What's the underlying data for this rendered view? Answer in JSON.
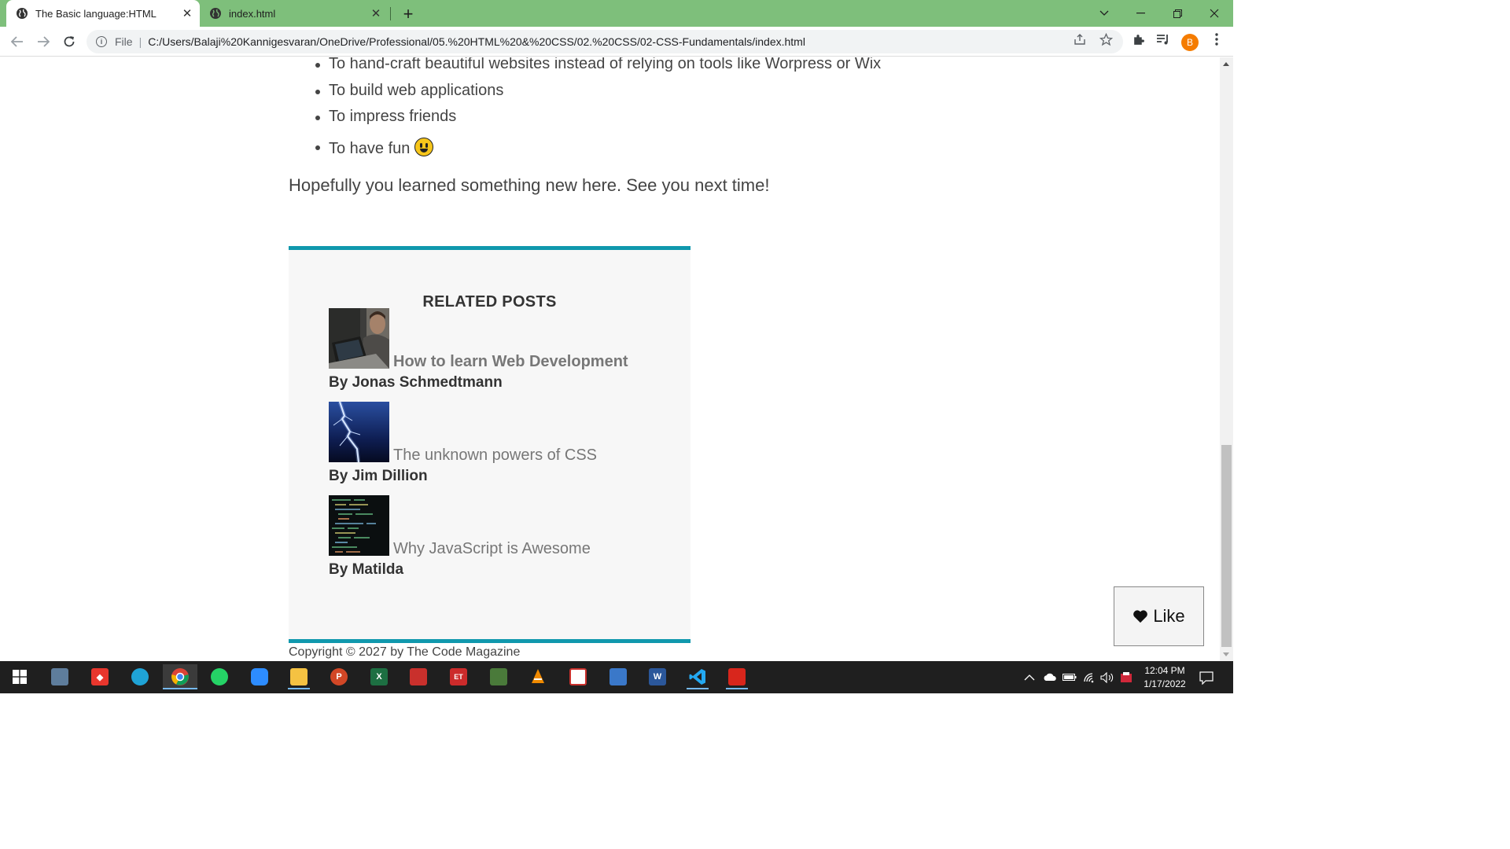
{
  "browser": {
    "tabs": [
      {
        "title": "The Basic language:HTML",
        "active": true
      },
      {
        "title": "index.html",
        "active": false
      }
    ],
    "address": {
      "scheme": "File",
      "url": "C:/Users/Balaji%20Kannigesvaran/OneDrive/Professional/05.%20HTML%20&%20CSS/02.%20CSS/02-CSS-Fundamentals/index.html"
    },
    "profile_initial": "B",
    "accent": "#7ebf7b"
  },
  "page": {
    "reasons": [
      "To hand-craft beautiful websites instead of relying on tools like Worpress or Wix",
      "To build web applications",
      "To impress friends",
      "To have fun"
    ],
    "closing": "Hopefully you learned something new here. See you next time!",
    "related": {
      "heading": "RELATED POSTS",
      "posts": [
        {
          "title": "How to learn Web Development",
          "author": "By Jonas Schmedtmann",
          "thumb": "person-laptop-photo"
        },
        {
          "title": "The unknown powers of CSS",
          "author": "By Jim Dillion",
          "thumb": "lightning-photo"
        },
        {
          "title": "Why JavaScript is Awesome",
          "author": "By Matilda",
          "thumb": "code-screen-photo"
        }
      ]
    },
    "copyright": "Copyright © 2027 by The Code Magazine",
    "like_label": "Like",
    "border_color": "#1098ad"
  },
  "taskbar": {
    "clock_time": "12:04 PM",
    "clock_date": "1/17/2022",
    "apps": [
      "start",
      "photos",
      "anydesk",
      "edge",
      "chrome",
      "whatsapp",
      "zoom",
      "file-explorer",
      "powerpoint",
      "excel",
      "pdf-reader",
      "et",
      "tally",
      "vlc",
      "foxit",
      "remote-desktop",
      "word",
      "vscode",
      "acrobat"
    ],
    "app_letters": {
      "powerpoint": "P",
      "excel": "X",
      "word": "W",
      "et": "ET"
    }
  }
}
